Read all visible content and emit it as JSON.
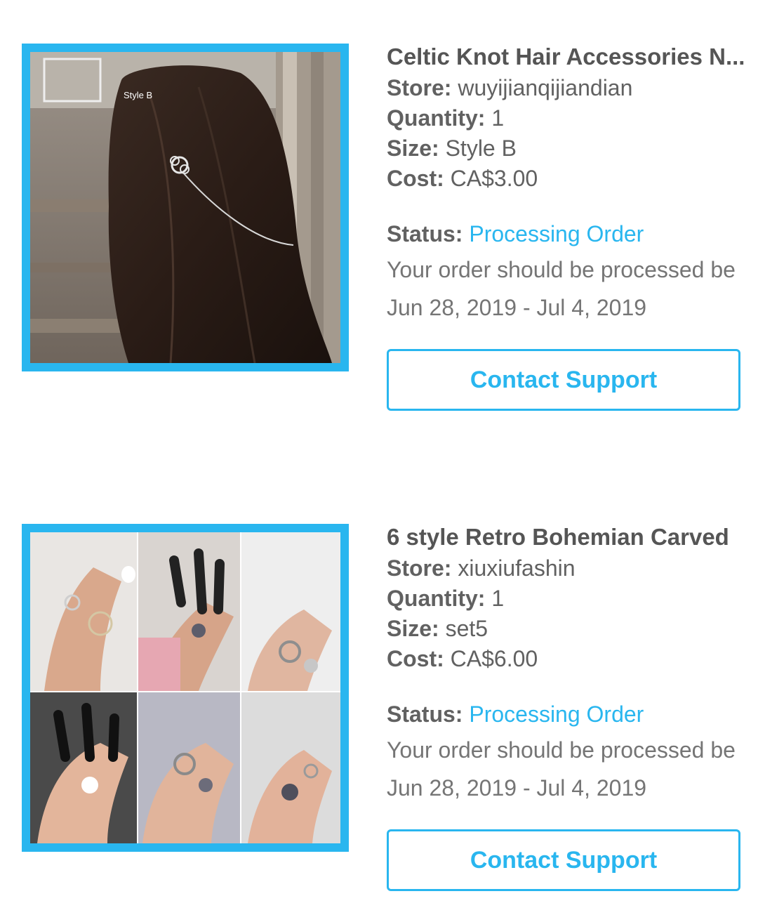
{
  "orders": [
    {
      "title": "Celtic Knot Hair Accessories N...",
      "store_label": "Store:",
      "store": "wuyijianqijiandian",
      "quantity_label": "Quantity:",
      "quantity": "1",
      "size_label": "Size:",
      "size": "Style B",
      "cost_label": "Cost:",
      "cost": "CA$3.00",
      "status_label": "Status:",
      "status": "Processing Order",
      "message": "Your order should be processed be",
      "date_range": "Jun 28, 2019 - Jul 4, 2019",
      "button_label": "Contact Support",
      "image_caption": "Style B"
    },
    {
      "title": "6 style Retro Bohemian Carved",
      "store_label": "Store:",
      "store": "xiuxiufashin",
      "quantity_label": "Quantity:",
      "quantity": "1",
      "size_label": "Size:",
      "size": "set5",
      "cost_label": "Cost:",
      "cost": "CA$6.00",
      "status_label": "Status:",
      "status": "Processing Order",
      "message": "Your order should be processed be",
      "date_range": "Jun 28, 2019 - Jul 4, 2019",
      "button_label": "Contact Support"
    }
  ],
  "colors": {
    "accent": "#29b6ef",
    "label": "#616161",
    "text": "#757575"
  }
}
